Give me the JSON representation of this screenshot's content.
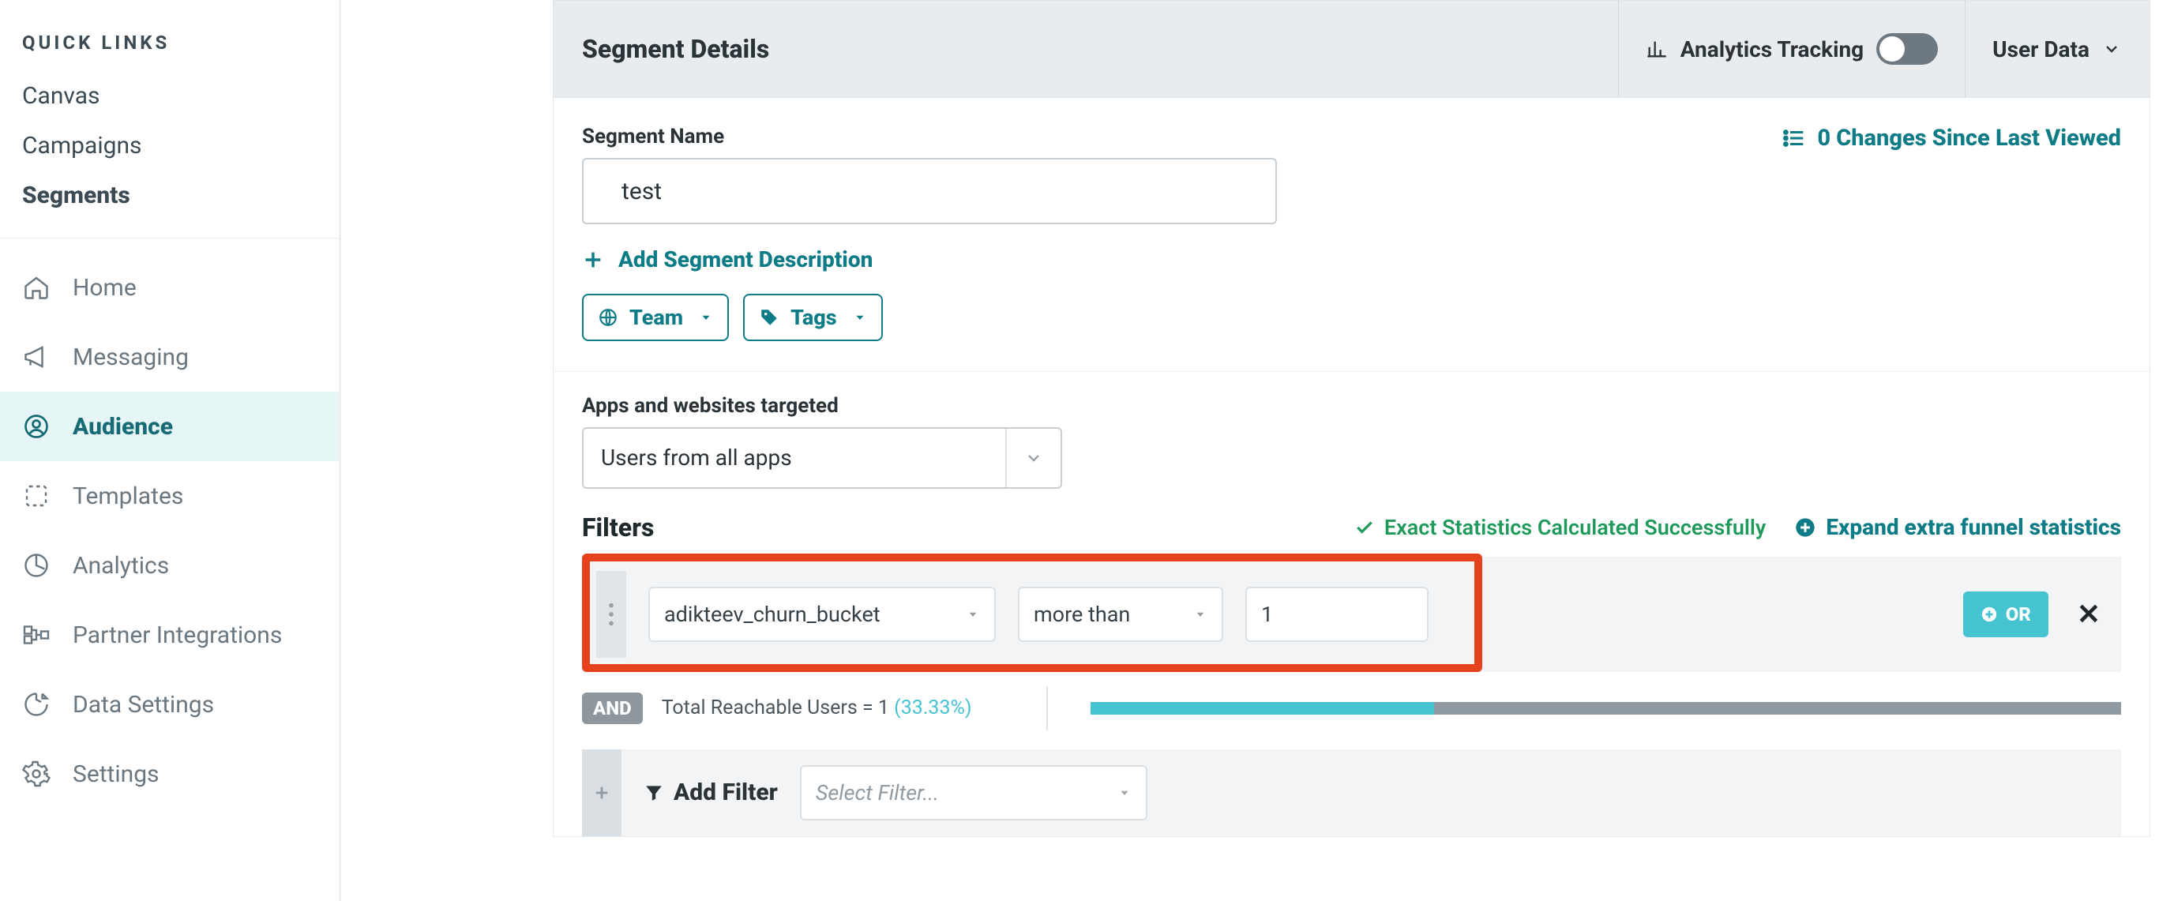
{
  "sidebar": {
    "quick_title": "QUICK LINKS",
    "quick": [
      "Canvas",
      "Campaigns",
      "Segments"
    ],
    "quick_active_index": 2,
    "nav": [
      {
        "label": "Home"
      },
      {
        "label": "Messaging"
      },
      {
        "label": "Audience"
      },
      {
        "label": "Templates"
      },
      {
        "label": "Analytics"
      },
      {
        "label": "Partner Integrations"
      },
      {
        "label": "Data Settings"
      },
      {
        "label": "Settings"
      }
    ],
    "nav_active_index": 2
  },
  "header": {
    "title": "Segment Details",
    "analytics_label": "Analytics Tracking",
    "analytics_on": false,
    "user_data_label": "User Data"
  },
  "segment": {
    "name_label": "Segment Name",
    "name_value": "test",
    "changes_link": "0 Changes Since Last Viewed",
    "add_description": "Add Segment Description",
    "team_label": "Team",
    "tags_label": "Tags"
  },
  "targeting": {
    "apps_label": "Apps and websites targeted",
    "apps_value": "Users from all apps"
  },
  "filters": {
    "title": "Filters",
    "status_text": "Exact Statistics Calculated Successfully",
    "expand_text": "Expand extra funnel statistics",
    "row": {
      "attribute": "adikteev_churn_bucket",
      "operator": "more than",
      "value": "1",
      "or_label": "OR"
    },
    "and_label": "AND",
    "reach_prefix": "Total Reachable Users = ",
    "reach_value": "1",
    "reach_pct": "(33.33%)",
    "bar_fill_pct": 33.33,
    "add_filter_label": "Add Filter",
    "select_filter_placeholder": "Select Filter..."
  }
}
